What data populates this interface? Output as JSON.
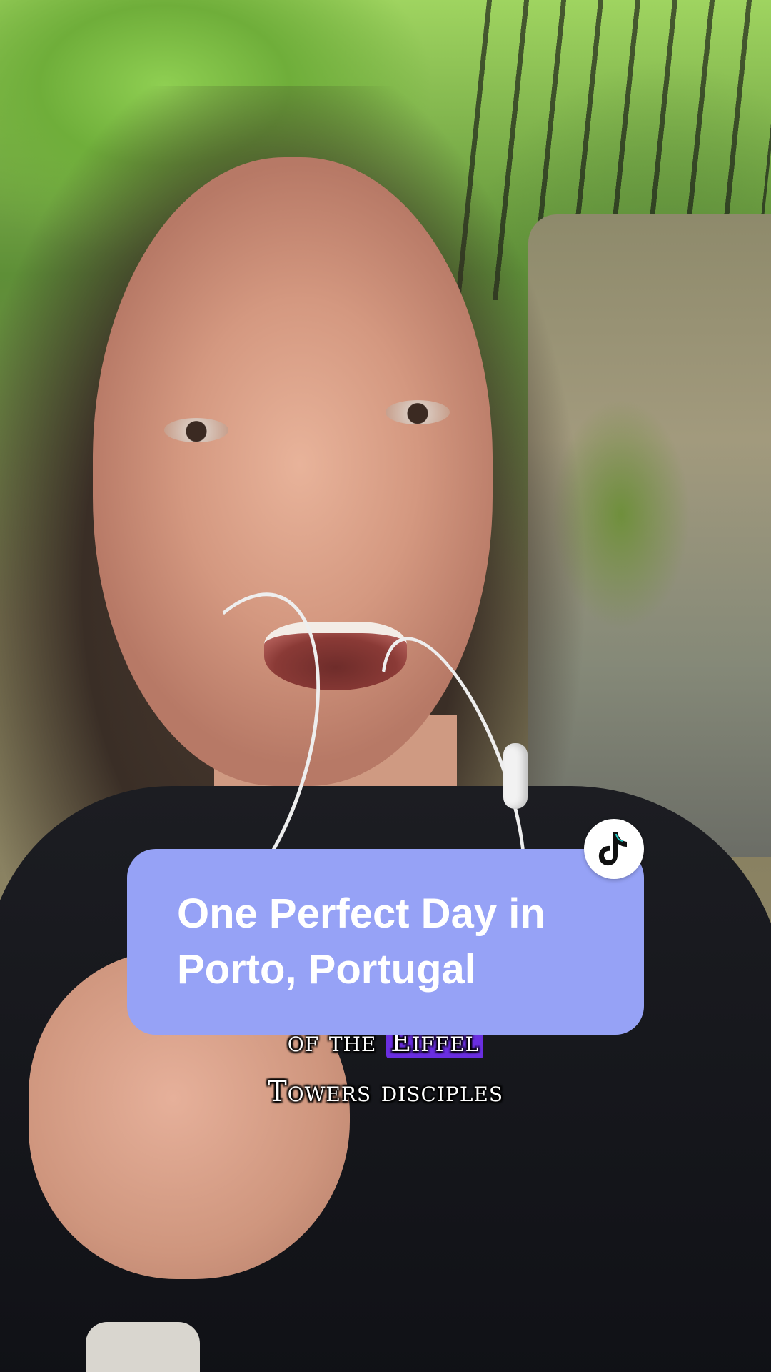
{
  "title_card": {
    "line1": "One Perfect Day in",
    "line2": "Porto, Portugal",
    "color": "#96a2f6"
  },
  "subtitles": {
    "line1_before": "of the ",
    "line1_highlight": "Eiffel",
    "line2": "Towers disciples",
    "highlight_color": "#6a2ee0"
  },
  "badge": {
    "icon": "tiktok-icon"
  }
}
